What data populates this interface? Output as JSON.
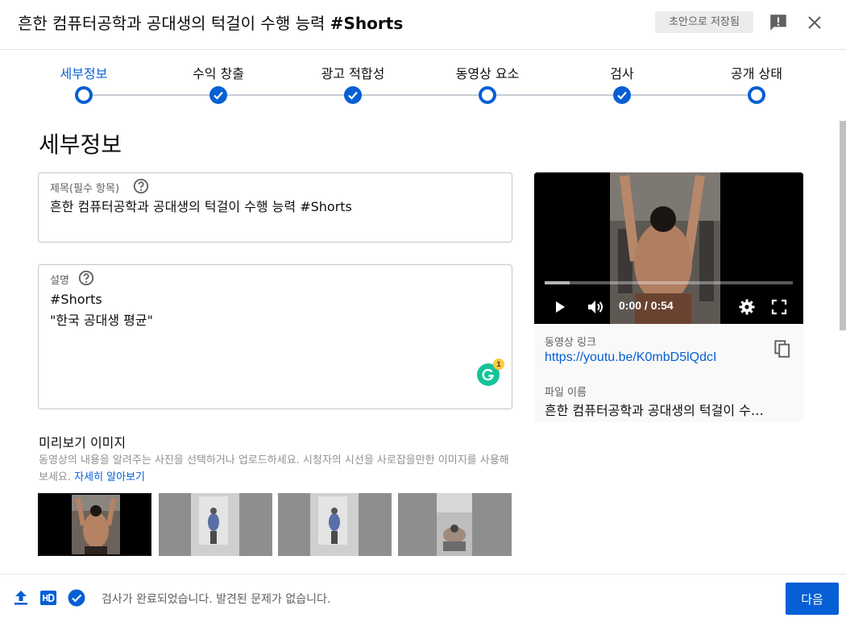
{
  "header": {
    "title_prefix": "흔한 컴퓨터공학과 공대생의 턱걸이 수행 능력 ",
    "title_tag": "#Shorts",
    "draft_status": "초안으로 저장됨"
  },
  "stepper": {
    "steps": [
      {
        "label": "세부정보",
        "state": "active"
      },
      {
        "label": "수익 창출",
        "state": "done"
      },
      {
        "label": "광고 적합성",
        "state": "done"
      },
      {
        "label": "동영상 요소",
        "state": "open"
      },
      {
        "label": "검사",
        "state": "done"
      },
      {
        "label": "공개 상태",
        "state": "open"
      }
    ]
  },
  "details": {
    "heading": "세부정보",
    "title_field": {
      "label": "제목(필수 항목)",
      "value": "흔한 컴퓨터공학과 공대생의 턱걸이 수행 능력 #Shorts"
    },
    "description_field": {
      "label": "설명",
      "value": "#Shorts\n\"한국 공대생 평균\""
    },
    "grammarly_count": "1"
  },
  "thumbnail": {
    "title": "미리보기 이미지",
    "description": "동영상의 내용을 알려주는 사진을 선택하거나 업로드하세요. 시청자의 시선을 사로잡을만한 이미지를 사용해 보세요. ",
    "learn_more": "자세히 알아보기",
    "options": [
      "thumbnail-1",
      "thumbnail-2",
      "thumbnail-3",
      "thumbnail-4"
    ],
    "selected_index": 0
  },
  "preview": {
    "time": "0:00 / 0:54",
    "progress": 0.1,
    "link_label": "동영상 링크",
    "link": "https://youtu.be/K0mbD5lQdcI",
    "file_label": "파일 이름",
    "file_name": "흔한 컴퓨터공학과 공대생의 턱걸이 수…"
  },
  "footer": {
    "status": "검사가 완료되었습니다. 발견된 문제가 없습니다.",
    "next_label": "다음"
  },
  "colors": {
    "accent": "#065fd4",
    "grammarly": "#15c39a"
  }
}
